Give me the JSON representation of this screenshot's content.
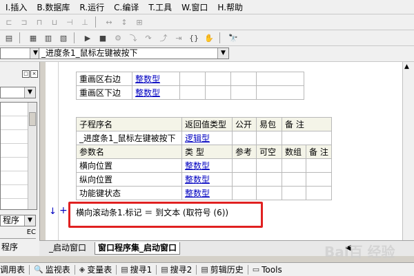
{
  "menu": [
    "I.插入",
    "B.数据库",
    "R.运行",
    "C.编译",
    "T.工具",
    "W.窗口",
    "H.帮助"
  ],
  "toolbar1_icons": [
    "align-left-icon",
    "align-center-icon",
    "align-right-icon",
    "spacing-icon",
    "spacing-vertical-icon",
    "same-width-icon",
    "same-height-icon",
    "same-size-icon"
  ],
  "toolbar2_icons": [
    "window-list-icon",
    "layout1-icon",
    "layout2-icon",
    "layout3-icon",
    "run-icon",
    "stop-icon",
    "compile-icon",
    "step-into-icon",
    "step-over-icon",
    "step-out-icon",
    "run-to-cursor-icon",
    "bookmark-icon",
    "hand-icon",
    "find-icon"
  ],
  "combo_event": "_进度条1_鼠标左键被按下",
  "left_panel": {
    "combo_bottom": "程序",
    "col_header": "EC",
    "tab_label": "程序"
  },
  "table_top": [
    {
      "name": "重画区右边",
      "type": "整数型"
    },
    {
      "name": "重画区下边",
      "type": "整数型"
    }
  ],
  "sub_header": [
    "子程序名",
    "返回值类型",
    "公开",
    "易包",
    "备 注"
  ],
  "sub_row": {
    "name": "_进度条1_鼠标左键被按下",
    "ret": "逻辑型"
  },
  "param_header": [
    "参数名",
    "类 型",
    "参考",
    "可空",
    "数组",
    "备 注"
  ],
  "params": [
    {
      "name": "横向位置",
      "type": "整数型"
    },
    {
      "name": "纵向位置",
      "type": "整数型"
    },
    {
      "name": "功能键状态",
      "type": "整数型"
    }
  ],
  "code_line": "横向滚动条1.标记 ＝ 到文本 (取符号 (6))",
  "tabs": [
    "_启动窗口",
    "窗口程序集_启动窗口"
  ],
  "bottom_bar": [
    "调用表",
    "监视表",
    "变量表",
    "搜寻1",
    "搜寻2",
    "剪辑历史",
    "Tools"
  ],
  "watermark": "Bai百 经验"
}
